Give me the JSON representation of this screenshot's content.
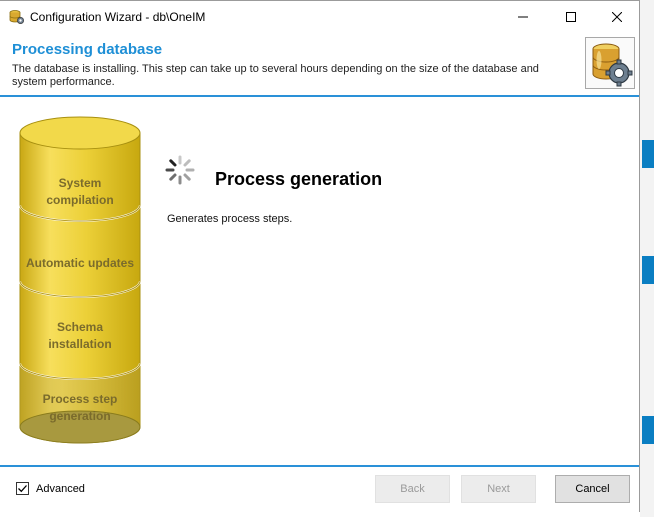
{
  "window": {
    "title": "Configuration Wizard - db\\OneIM",
    "controls": {
      "minimize": "minimize",
      "maximize": "maximize",
      "close": "close"
    }
  },
  "header": {
    "title": "Processing database",
    "description": "The database is installing. This step can take up to several hours depending on the size of the database and system performance."
  },
  "steps": [
    {
      "label": "System compilation",
      "line1": "System",
      "line2": "compilation"
    },
    {
      "label": "Automatic updates",
      "line1": "Automatic updates",
      "line2": ""
    },
    {
      "label": "Schema installation",
      "line1": "Schema",
      "line2": "installation"
    },
    {
      "label": "Process step generation",
      "line1": "Process step",
      "line2": "generation"
    }
  ],
  "current_step": {
    "title": "Process generation",
    "description": "Generates process steps."
  },
  "footer": {
    "advanced_label": "Advanced",
    "advanced_checked": true,
    "back_label": "Back",
    "next_label": "Next",
    "cancel_label": "Cancel"
  },
  "colors": {
    "accent": "#1e8fd6",
    "cylinder_fill": "#e8c930",
    "cylinder_text": "#7a6b2c",
    "cylinder_active": "#a39a52"
  },
  "icons": {
    "app": "database-gear-icon",
    "header": "database-gear-icon",
    "spinner": "loading-spinner-icon",
    "checkbox": "checkmark-icon"
  }
}
